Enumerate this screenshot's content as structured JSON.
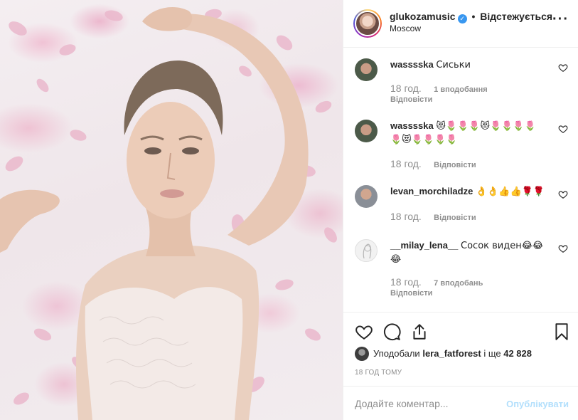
{
  "post": {
    "username": "glukozamusic",
    "verified_mark": "✓",
    "separator": "•",
    "follow_state": "Відстежується",
    "location": "Moscow",
    "more_icon": "more-options-icon"
  },
  "comments": [
    {
      "username": "wasssska",
      "text": "Сиськи",
      "time": "18 год.",
      "likes": "1 вподобання",
      "reply": "Відповісти"
    },
    {
      "username": "wasssska",
      "text": "😻🌷🌷🌷😻🌷🌷🌷🌷🌷😻🌷🌷🌷🌷",
      "time": "18 год.",
      "likes": "",
      "reply": "Відповісти"
    },
    {
      "username": "levan_morchiladze",
      "text": "👌👌👍👍🌹🌹",
      "time": "18 год.",
      "likes": "",
      "reply": "Відповісти"
    },
    {
      "username": "__milay_lena__",
      "text": "Сосок виден😂😂😂",
      "time": "18 год.",
      "likes": "7 вподобань",
      "reply": "Відповісти"
    }
  ],
  "actions": {
    "like_icon": "heart-icon",
    "comment_icon": "comment-icon",
    "share_icon": "share-icon",
    "save_icon": "bookmark-icon"
  },
  "likes_line": {
    "prefix": "Уподобали",
    "user": "lera_fatforest",
    "suffix": "і ще",
    "count": "42 828"
  },
  "time_ago": "18 ГОД ТОМУ",
  "comment_input": {
    "placeholder": "Додайте коментар...",
    "value": ""
  },
  "publish_label": "Опублікувати",
  "colors": {
    "accent": "#3897f0",
    "publish_disabled": "#b2dffc",
    "muted": "#8e8e8e",
    "text": "#262626"
  }
}
